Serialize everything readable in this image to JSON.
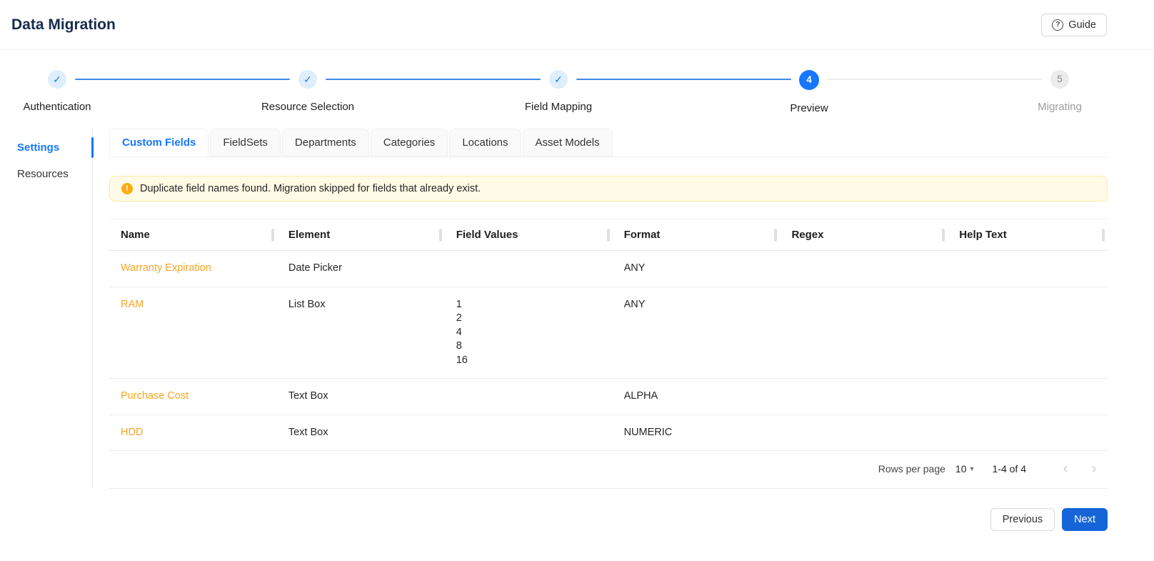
{
  "header": {
    "title": "Data Migration",
    "guide_label": "Guide"
  },
  "icons": {
    "check": "✓",
    "question": "?",
    "warning": "!",
    "caret_down": "▾",
    "chevron_left": "‹",
    "chevron_right": "›"
  },
  "stepper": {
    "steps": [
      {
        "label": "Authentication",
        "status": "done"
      },
      {
        "label": "Resource Selection",
        "status": "done"
      },
      {
        "label": "Field Mapping",
        "status": "done"
      },
      {
        "label": "Preview",
        "status": "active",
        "number": "4"
      },
      {
        "label": "Migrating",
        "status": "pending",
        "number": "5"
      }
    ]
  },
  "sidebar": {
    "items": [
      {
        "label": "Settings",
        "active": true
      },
      {
        "label": "Resources",
        "active": false
      }
    ]
  },
  "tabs": [
    {
      "label": "Custom Fields",
      "active": true
    },
    {
      "label": "FieldSets",
      "active": false
    },
    {
      "label": "Departments",
      "active": false
    },
    {
      "label": "Categories",
      "active": false
    },
    {
      "label": "Locations",
      "active": false
    },
    {
      "label": "Asset Models",
      "active": false
    }
  ],
  "alert": {
    "message": "Duplicate field names found. Migration skipped for fields that already exist."
  },
  "table": {
    "columns": [
      "Name",
      "Element",
      "Field Values",
      "Format",
      "Regex",
      "Help Text"
    ],
    "rows": [
      {
        "name": "Warranty Expiration",
        "element": "Date Picker",
        "field_values": [],
        "format": "ANY",
        "regex": "",
        "help_text": ""
      },
      {
        "name": "RAM",
        "element": "List Box",
        "field_values": [
          "1",
          "2",
          "4",
          "8",
          "16"
        ],
        "format": "ANY",
        "regex": "",
        "help_text": ""
      },
      {
        "name": "Purchase Cost",
        "element": "Text Box",
        "field_values": [],
        "format": "ALPHA",
        "regex": "",
        "help_text": ""
      },
      {
        "name": "HDD",
        "element": "Text Box",
        "field_values": [],
        "format": "NUMERIC",
        "regex": "",
        "help_text": ""
      }
    ],
    "pagination": {
      "rows_per_page_label": "Rows per page",
      "rows_per_page_value": "10",
      "range_label": "1-4 of 4"
    }
  },
  "footer": {
    "previous_label": "Previous",
    "next_label": "Next"
  },
  "colors": {
    "accent_blue": "#1677ff",
    "next_button_blue": "#1565d8",
    "link_orange": "#f5a623",
    "warning_bg": "#fffbe6",
    "warning_border": "#ffe9a8",
    "warning_icon": "#faad14"
  }
}
